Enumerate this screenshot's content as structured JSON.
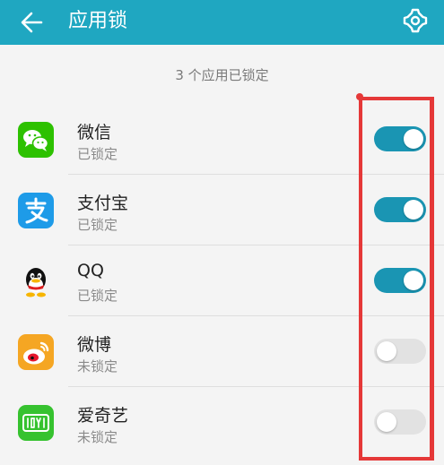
{
  "header": {
    "title": "应用锁",
    "back_icon": "arrow-left-icon",
    "settings_icon": "gear-icon"
  },
  "summary": "3 个应用已锁定",
  "apps": [
    {
      "name": "微信",
      "status": "已锁定",
      "locked": true,
      "icon": "wechat-icon",
      "icon_color": "#2dc100"
    },
    {
      "name": "支付宝",
      "status": "已锁定",
      "locked": true,
      "icon": "alipay-icon",
      "icon_color": "#1e9be8"
    },
    {
      "name": "QQ",
      "status": "已锁定",
      "locked": true,
      "icon": "qq-icon",
      "icon_color": "#111111"
    },
    {
      "name": "微博",
      "status": "未锁定",
      "locked": false,
      "icon": "weibo-icon",
      "icon_color": "#f5a623"
    },
    {
      "name": "爱奇艺",
      "status": "未锁定",
      "locked": false,
      "icon": "iqiyi-icon",
      "icon_color": "#36c22f"
    }
  ],
  "colors": {
    "header": "#1fa7c1",
    "toggle_on": "#1a95b3",
    "toggle_off": "#e2e2e2",
    "highlight": "#e53838"
  }
}
